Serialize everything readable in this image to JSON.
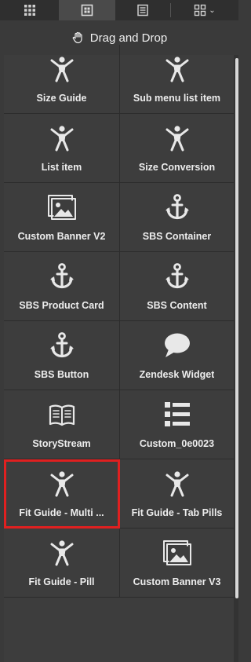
{
  "toolbar": {
    "tabs": [
      {
        "icon": "grid-icon",
        "active": false
      },
      {
        "icon": "component-icon",
        "active": true
      },
      {
        "icon": "document-icon",
        "active": false
      },
      {
        "icon": "layout-dropdown-icon",
        "active": false
      }
    ]
  },
  "section": {
    "title": "Drag and Drop",
    "icon": "hand-icon"
  },
  "widgets": [
    {
      "label": "Size Guide",
      "icon": "person-icon"
    },
    {
      "label": "Sub menu list item",
      "icon": "person-icon"
    },
    {
      "label": "List item",
      "icon": "person-icon"
    },
    {
      "label": "Size Conversion",
      "icon": "person-icon"
    },
    {
      "label": "Custom Banner V2",
      "icon": "image-icon"
    },
    {
      "label": "SBS Container",
      "icon": "anchor-icon"
    },
    {
      "label": "SBS Product Card",
      "icon": "anchor-icon"
    },
    {
      "label": "SBS Content",
      "icon": "anchor-icon"
    },
    {
      "label": "SBS Button",
      "icon": "anchor-icon"
    },
    {
      "label": "Zendesk Widget",
      "icon": "chat-bubble-icon"
    },
    {
      "label": "StoryStream",
      "icon": "book-icon"
    },
    {
      "label": "Custom_0e0023",
      "icon": "list-icon"
    },
    {
      "label": "Fit Guide - Multi ...",
      "icon": "person-icon",
      "selected": true
    },
    {
      "label": "Fit Guide - Tab Pills",
      "icon": "person-icon"
    },
    {
      "label": "Fit Guide - Pill",
      "icon": "person-icon"
    },
    {
      "label": "Custom Banner V3",
      "icon": "image-icon"
    }
  ],
  "colors": {
    "background": "#3a3a3a",
    "selection_outline": "#e02020"
  }
}
